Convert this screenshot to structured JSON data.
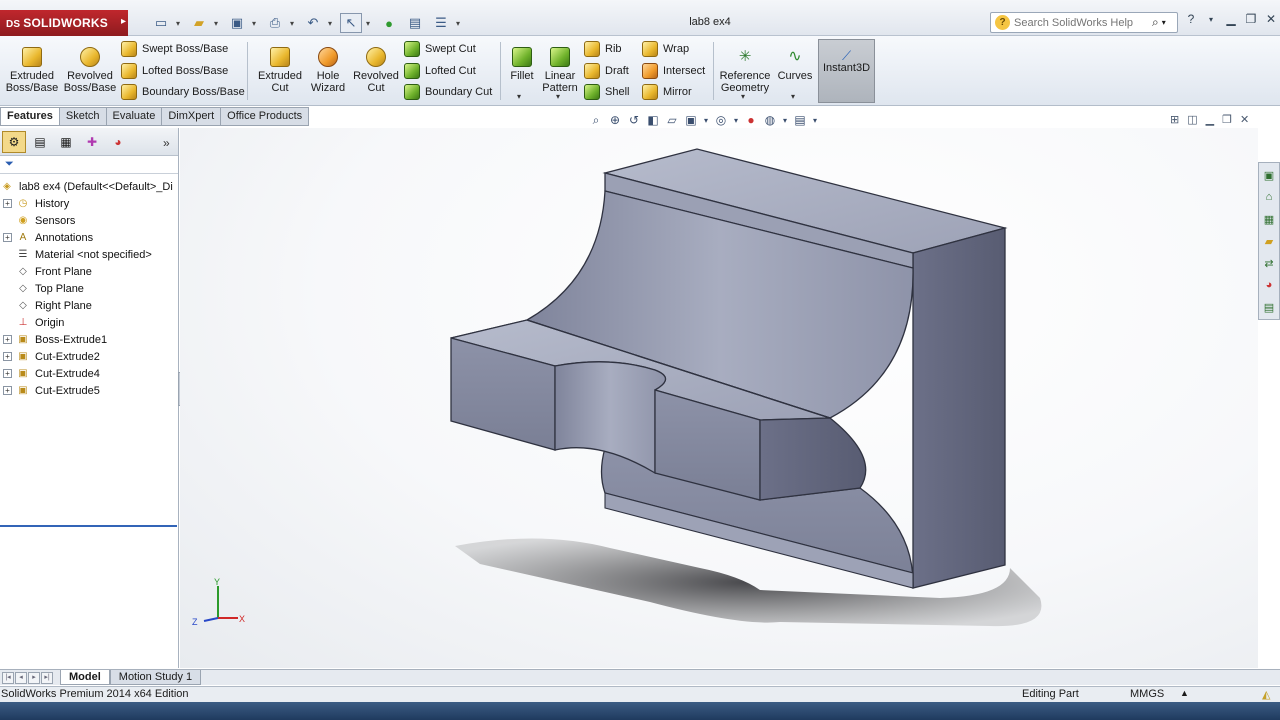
{
  "app": {
    "logo_text": "SOLIDWORKS",
    "logo_mark": "DS",
    "document_title": "lab8 ex4"
  },
  "search": {
    "placeholder": "Search SolidWorks Help",
    "icon": "magnifier-icon"
  },
  "ribbon": {
    "extruded_boss": "Extruded Boss/Base",
    "revolved_boss": "Revolved Boss/Base",
    "swept_boss": "Swept Boss/Base",
    "lofted_boss": "Lofted Boss/Base",
    "boundary_boss": "Boundary Boss/Base",
    "extruded_cut": "Extruded Cut",
    "hole_wizard": "Hole Wizard",
    "revolved_cut": "Revolved Cut",
    "swept_cut": "Swept Cut",
    "lofted_cut": "Lofted Cut",
    "boundary_cut": "Boundary Cut",
    "fillet": "Fillet",
    "linear_pattern": "Linear Pattern",
    "rib": "Rib",
    "draft": "Draft",
    "shell": "Shell",
    "wrap": "Wrap",
    "intersect": "Intersect",
    "mirror": "Mirror",
    "reference_geometry": "Reference Geometry",
    "curves": "Curves",
    "instant3d": "Instant3D"
  },
  "command_tabs": [
    "Features",
    "Sketch",
    "Evaluate",
    "DimXpert",
    "Office Products"
  ],
  "feature_tree": {
    "root": "lab8 ex4  (Default<<Default>_Di",
    "items": [
      {
        "label": "History",
        "icon": "history-icon",
        "expandable": true
      },
      {
        "label": "Sensors",
        "icon": "sensor-icon",
        "expandable": false
      },
      {
        "label": "Annotations",
        "icon": "annotation-icon",
        "expandable": true
      },
      {
        "label": "Material <not specified>",
        "icon": "material-icon",
        "expandable": false
      },
      {
        "label": "Front Plane",
        "icon": "plane-icon",
        "expandable": false
      },
      {
        "label": "Top Plane",
        "icon": "plane-icon",
        "expandable": false
      },
      {
        "label": "Right Plane",
        "icon": "plane-icon",
        "expandable": false
      },
      {
        "label": "Origin",
        "icon": "origin-icon",
        "expandable": false
      },
      {
        "label": "Boss-Extrude1",
        "icon": "boss-extrude-icon",
        "expandable": true
      },
      {
        "label": "Cut-Extrude2",
        "icon": "cut-extrude-icon",
        "expandable": true
      },
      {
        "label": "Cut-Extrude4",
        "icon": "cut-extrude-icon",
        "expandable": true
      },
      {
        "label": "Cut-Extrude5",
        "icon": "cut-extrude-icon",
        "expandable": true
      }
    ]
  },
  "triad": {
    "x": "X",
    "y": "Y",
    "z": "Z"
  },
  "bottom_tabs": [
    "Model",
    "Motion Study 1"
  ],
  "status": {
    "edition": "SolidWorks Premium 2014 x64 Edition",
    "mode": "Editing Part",
    "units": "MMGS"
  },
  "colors": {
    "brand": "#c0272d",
    "part_face_light": "#a6abbf",
    "part_face_mid": "#8c91a7",
    "part_face_dark": "#60647a"
  }
}
